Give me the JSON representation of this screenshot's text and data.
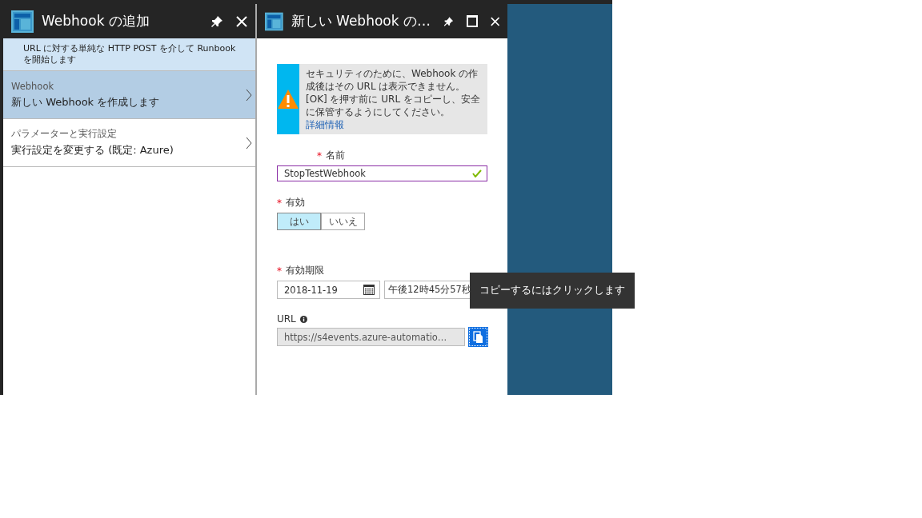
{
  "blade_1": {
    "title": "Webhook の追加",
    "description": "URL に対する単純な HTTP POST を介して Runbook を開始します",
    "items": [
      {
        "label": "Webhook",
        "value": "新しい Webhook を作成します",
        "selected": true
      },
      {
        "label": "パラメーターと実行設定",
        "value": "実行設定を変更する (既定: Azure)",
        "selected": false
      }
    ]
  },
  "blade_2": {
    "title": "新しい Webhook の…",
    "warning": {
      "text": "セキュリティのために、Webhook の作成後はその URL は表示できません。[OK] を押す前に URL をコピーし、安全に保管するようにしてください。",
      "link": "詳細情報"
    },
    "name": {
      "label": "名前",
      "required_mark": "*",
      "value": "StopTestWebhook",
      "valid": true
    },
    "enabled": {
      "label": "有効",
      "required_mark": "*",
      "options": [
        {
          "label": "はい",
          "selected": true
        },
        {
          "label": "いいえ",
          "selected": false
        }
      ]
    },
    "expires": {
      "label": "有効期限",
      "required_mark": "*",
      "date": "2018-11-19",
      "time": "午後12時45分57秒"
    },
    "url": {
      "label": "URL",
      "value": "https://s4events.azure-automatio…"
    },
    "tooltip": "コピーするにはクリックします"
  }
}
